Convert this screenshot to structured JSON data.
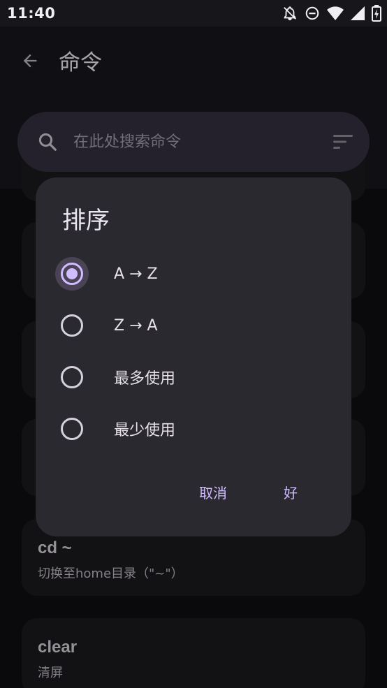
{
  "status_bar": {
    "time": "11:40",
    "icons": [
      "bell-off-icon",
      "do-not-disturb-icon",
      "wifi-icon",
      "signal-icon",
      "battery-icon"
    ]
  },
  "app_bar": {
    "title": "命令",
    "back_icon": "arrow-back-icon"
  },
  "search": {
    "placeholder": "在此处搜索命令",
    "search_icon": "search-icon",
    "sort_icon": "sort-icon"
  },
  "commands": [
    {
      "title": "cd ~",
      "description": "切换至home目录（\"~\"）"
    },
    {
      "title": "clear",
      "description": "清屏"
    }
  ],
  "sort_dialog": {
    "title": "排序",
    "options": [
      {
        "label": "A → Z",
        "selected": true
      },
      {
        "label": "Z → A",
        "selected": false
      },
      {
        "label": "最多使用",
        "selected": false
      },
      {
        "label": "最少使用",
        "selected": false
      }
    ],
    "cancel_label": "取消",
    "ok_label": "好"
  },
  "colors": {
    "accent": "#d0bcff",
    "dialog_bg": "#2b2930",
    "search_bg": "#332f3e"
  }
}
